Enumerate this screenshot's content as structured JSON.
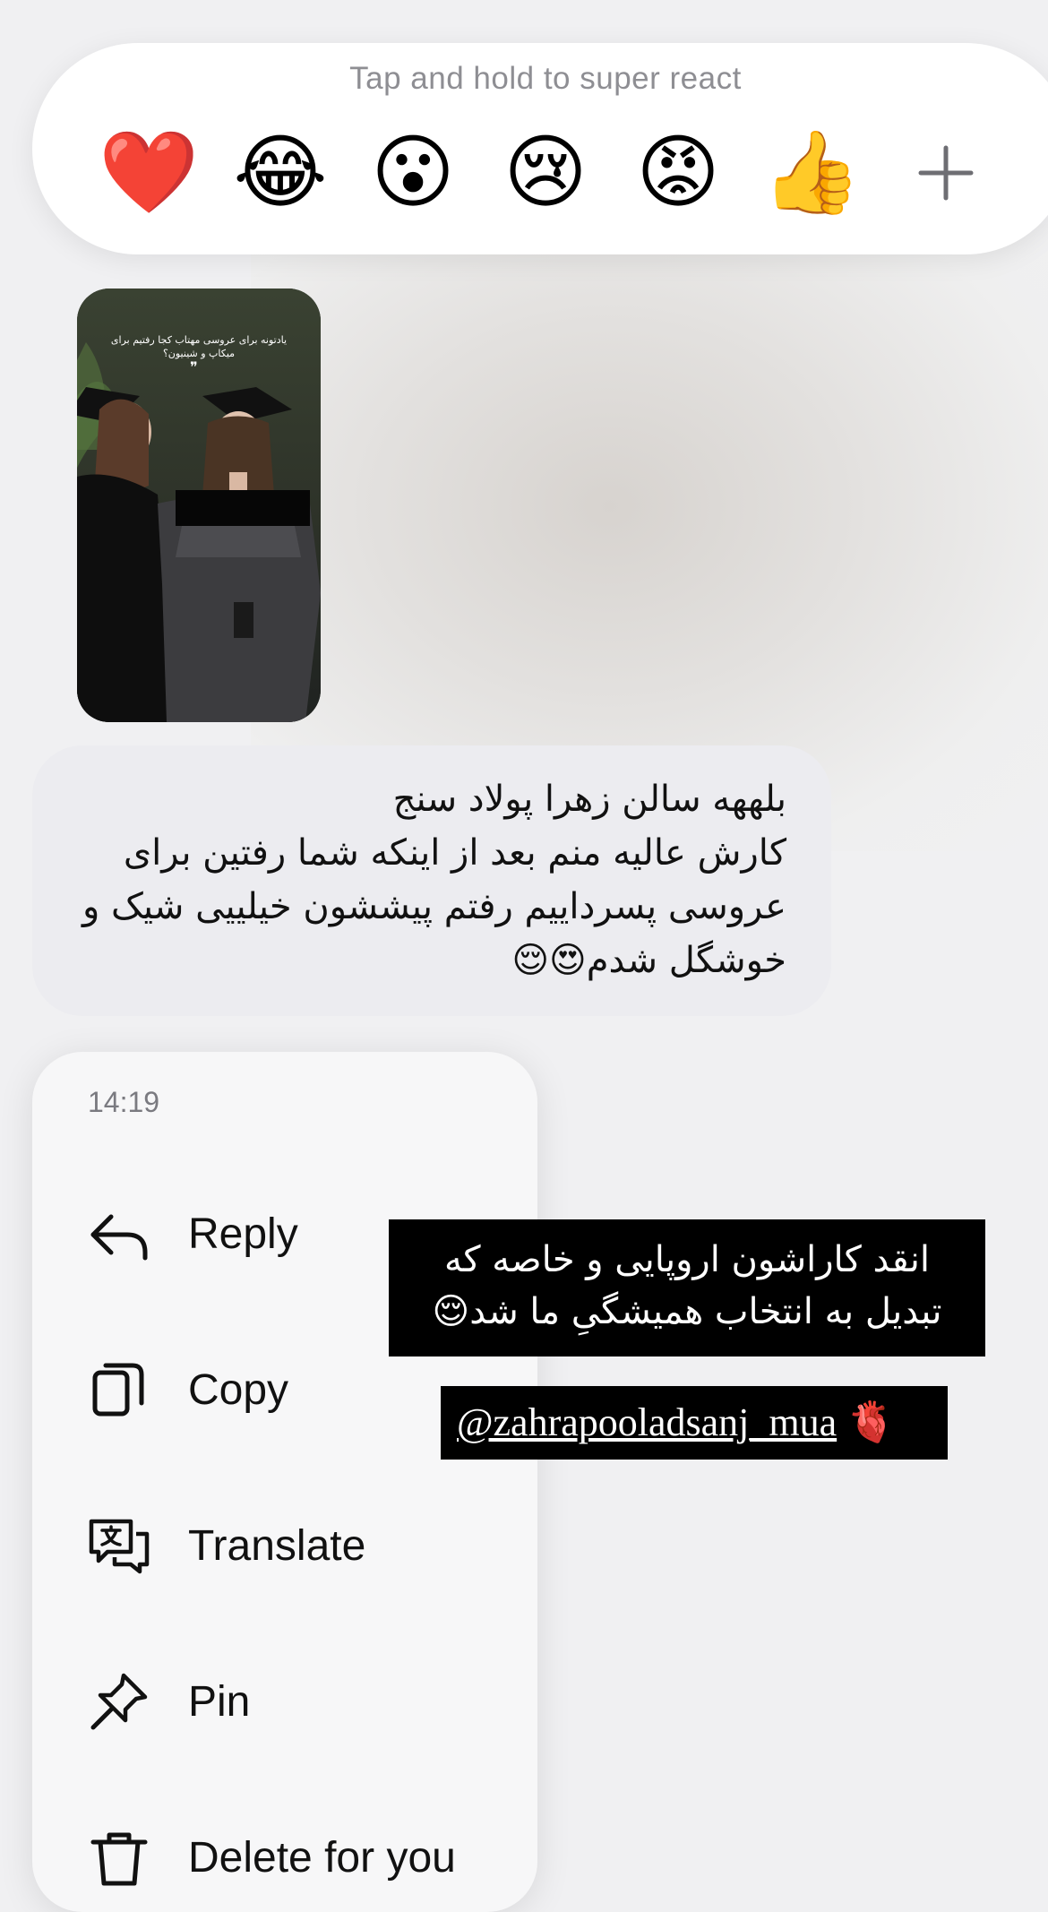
{
  "reactions": {
    "hint": "Tap and hold to super react",
    "emojis": [
      {
        "name": "heart",
        "glyph": "❤️"
      },
      {
        "name": "laughing",
        "glyph": "😂"
      },
      {
        "name": "surprised",
        "glyph": "😮"
      },
      {
        "name": "crying",
        "glyph": "😢"
      },
      {
        "name": "angry",
        "glyph": "😡"
      },
      {
        "name": "thumbs-up",
        "glyph": "👍"
      }
    ],
    "more_icon": "plus-icon"
  },
  "media": {
    "overlay_text": "یادتونه برای عروسی مهتاب کجا رفتیم برای میکاپ و شینیون؟",
    "quote_mark": "❞"
  },
  "message": {
    "text": "بلههه سالن زهرا پولاد سنج\nکارش عالیه منم بعد از اینکه شما رفتین برای عروسی پسرداییم رفتم پیششون خیلییی شیک و خوشگل شدم😍😌"
  },
  "context_menu": {
    "time": "14:19",
    "items": [
      {
        "label": "Reply",
        "icon": "reply-icon"
      },
      {
        "label": "Copy",
        "icon": "copy-icon"
      },
      {
        "label": "Translate",
        "icon": "translate-icon"
      },
      {
        "label": "Pin",
        "icon": "pin-icon"
      },
      {
        "label": "Delete for you",
        "icon": "trash-icon"
      }
    ]
  },
  "story_captions": {
    "line1": "انقد کاراشون اروپایی و خاصه که",
    "line2": "تبدیل به انتخاب همیشگیِ ما شد😌",
    "mention": "@zahrapooladsanj_mua",
    "mention_emoji": "🫀"
  },
  "colors": {
    "background": "#f0f0f2",
    "bubble": "#ececf0",
    "menu": "#f7f7f8",
    "hint_text": "#8e8e93"
  }
}
